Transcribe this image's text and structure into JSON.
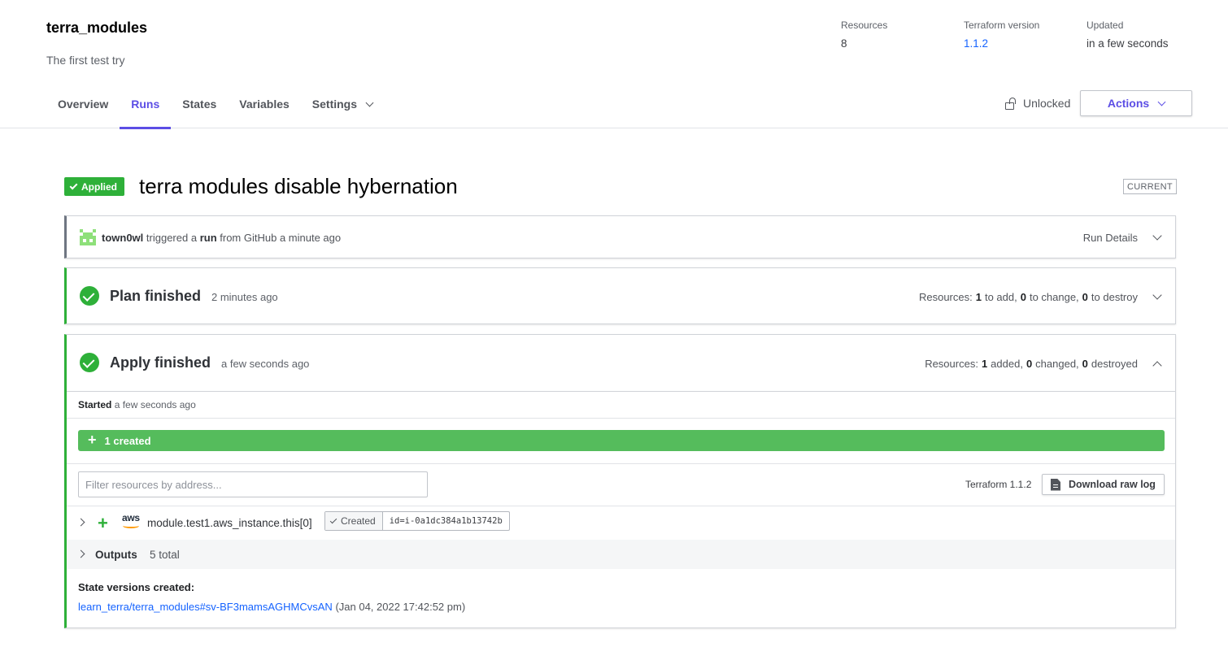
{
  "workspace": {
    "name": "terra_modules",
    "description": "The first test try",
    "meta": {
      "resources_label": "Resources",
      "resources_value": "8",
      "version_label": "Terraform version",
      "version_value": "1.1.2",
      "updated_label": "Updated",
      "updated_value": "in a few seconds"
    },
    "tabs": [
      {
        "label": "Overview",
        "active": false
      },
      {
        "label": "Runs",
        "active": true
      },
      {
        "label": "States",
        "active": false
      },
      {
        "label": "Variables",
        "active": false
      },
      {
        "label": "Settings",
        "active": false,
        "has_dropdown": true
      }
    ],
    "lock_status": "Unlocked",
    "actions_label": "Actions"
  },
  "run": {
    "status_badge": "Applied",
    "title": "terra modules disable hybernation",
    "current_badge": "CURRENT",
    "trigger": {
      "user": "town0wl",
      "text_1": "triggered a",
      "run_word": "run",
      "text_2": "from GitHub a minute ago",
      "details_label": "Run Details"
    },
    "plan": {
      "title": "Plan finished",
      "time": "2 minutes ago",
      "summary_prefix": "Resources:",
      "add": "1",
      "add_label": "to add,",
      "change": "0",
      "change_label": "to change,",
      "destroy": "0",
      "destroy_label": "to destroy"
    },
    "apply": {
      "title": "Apply finished",
      "time": "a few seconds ago",
      "summary_prefix": "Resources:",
      "added": "1",
      "added_label": "added,",
      "changed": "0",
      "changed_label": "changed,",
      "destroyed": "0",
      "destroyed_label": "destroyed",
      "started_label": "Started",
      "started_time": "a few seconds ago",
      "created_bar": "1 created",
      "filter_placeholder": "Filter resources by address...",
      "terraform_version": "Terraform 1.1.2",
      "download_label": "Download raw log",
      "resource": {
        "provider": "aws",
        "address": "module.test1.aws_instance.this[0]",
        "status": "Created",
        "id": "id=i-0a1dc384a1b13742b"
      },
      "outputs_label": "Outputs",
      "outputs_count": "5 total",
      "state_versions_title": "State versions created:",
      "state_version_link": "learn_terra/terra_modules#sv-BF3mamsAGHMCvsAN",
      "state_version_date": "(Jan 04, 2022 17:42:52 pm)"
    }
  },
  "colors": {
    "accent": "#5c4ee5",
    "success": "#2eb039",
    "created_bar": "#55bc5c",
    "link": "#1563ff",
    "aws_orange": "#ff9900"
  }
}
